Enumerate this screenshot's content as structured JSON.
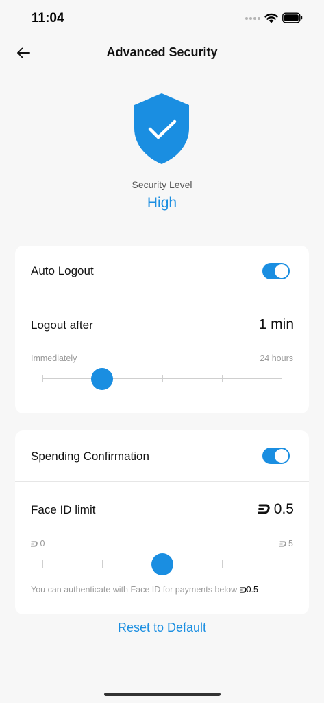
{
  "status_bar": {
    "time": "11:04"
  },
  "nav": {
    "title": "Advanced Security",
    "back_icon": "arrow-left-icon"
  },
  "hero": {
    "icon": "shield-check-icon",
    "label": "Security Level",
    "value": "High"
  },
  "auto_logout": {
    "label": "Auto Logout",
    "enabled": true,
    "logout_after_label": "Logout after",
    "logout_after_value": "1 min",
    "range_min_label": "Immediately",
    "range_max_label": "24 hours",
    "slider_steps": 5,
    "slider_index": 1
  },
  "spending": {
    "label": "Spending Confirmation",
    "enabled": true,
    "limit_label": "Face ID limit",
    "limit_value": "0.5",
    "range_min_label": "0",
    "range_max_label": "5",
    "slider_steps": 5,
    "slider_index": 2,
    "hint_text": "You can authenticate with Face ID for payments below",
    "hint_amount": "0.5",
    "currency_icon": "dash-coin-icon"
  },
  "reset_label": "Reset to Default",
  "colors": {
    "accent": "#1a8ee1",
    "background": "#f7f7f7",
    "card": "#ffffff"
  }
}
